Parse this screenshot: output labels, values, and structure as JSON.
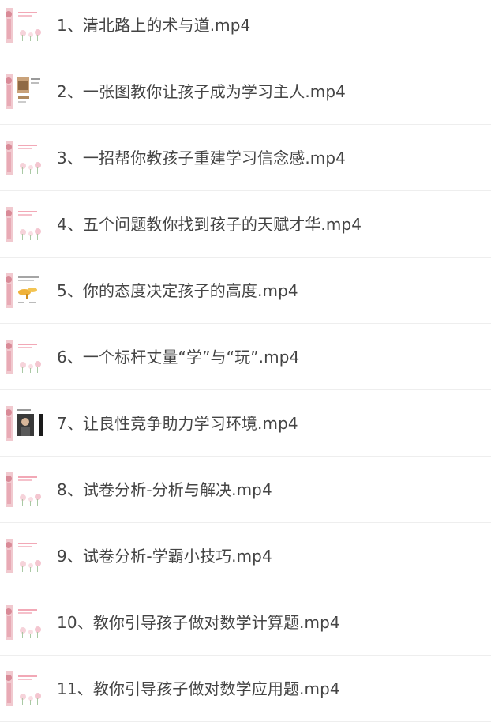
{
  "files": [
    {
      "title": "1、清北路上的术与道.mp4",
      "thumb": "pink-flower-card"
    },
    {
      "title": "2、一张图教你让孩子成为学习主人.mp4",
      "thumb": "photo-slide"
    },
    {
      "title": "3、一招帮你教孩子重建学习信念感.mp4",
      "thumb": "pink-flower-card"
    },
    {
      "title": "4、五个问题教你找到孩子的天赋才华.mp4",
      "thumb": "pink-flower-card"
    },
    {
      "title": "5、你的态度决定孩子的高度.mp4",
      "thumb": "yellow-illustration"
    },
    {
      "title": "6、一个标杆丈量“学”与“玩”.mp4",
      "thumb": "pink-flower-card"
    },
    {
      "title": "7、让良性竞争助力学习环境.mp4",
      "thumb": "portrait-slide"
    },
    {
      "title": "8、试卷分析-分析与解决.mp4",
      "thumb": "pink-flower-card"
    },
    {
      "title": "9、试卷分析-学霸小技巧.mp4",
      "thumb": "pink-flower-card"
    },
    {
      "title": "10、教你引导孩子做对数学计算题.mp4",
      "thumb": "pink-flower-card"
    },
    {
      "title": "11、教你引导孩子做对数学应用题.mp4",
      "thumb": "pink-flower-card"
    }
  ]
}
